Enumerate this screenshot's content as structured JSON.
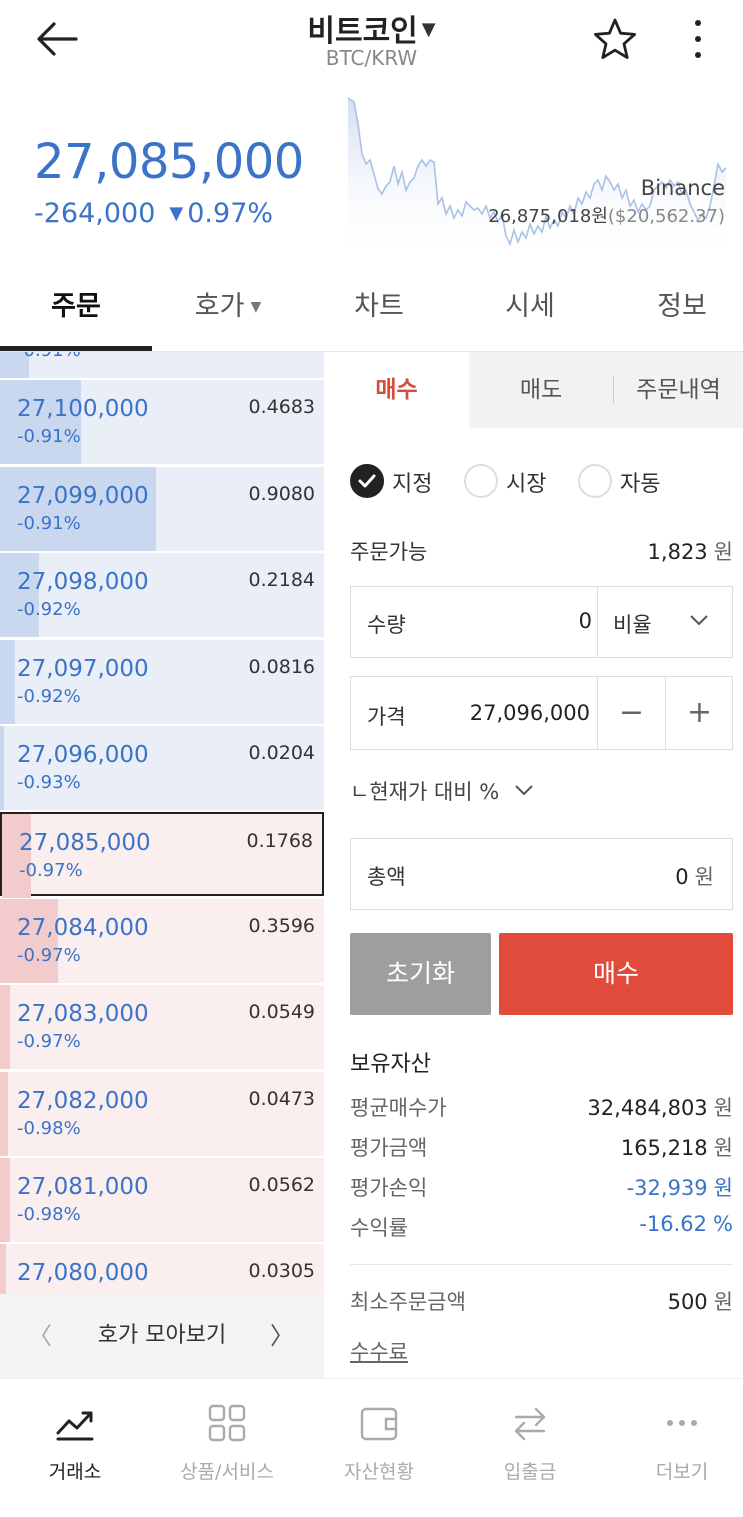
{
  "header": {
    "title": "비트코인",
    "subtitle": "BTC/KRW"
  },
  "ticker": {
    "price": "27,085,000",
    "change": "-264,000",
    "change_pct": "0.97%",
    "exchange": "Binance",
    "exchange_price": "26,875,018원",
    "exchange_usd": "($20,562.37)"
  },
  "tabs": [
    {
      "label": "주문"
    },
    {
      "label": "호가"
    },
    {
      "label": "차트"
    },
    {
      "label": "시세"
    },
    {
      "label": "정보"
    }
  ],
  "orderbook": {
    "rows": [
      {
        "price": "",
        "pct": "-0.91%",
        "qty": "",
        "side": "ask",
        "fill": 0.09
      },
      {
        "price": "27,100,000",
        "pct": "-0.91%",
        "qty": "0.4683",
        "side": "ask",
        "fill": 0.25
      },
      {
        "price": "27,099,000",
        "pct": "-0.91%",
        "qty": "0.9080",
        "side": "ask",
        "fill": 0.48
      },
      {
        "price": "27,098,000",
        "pct": "-0.92%",
        "qty": "0.2184",
        "side": "ask",
        "fill": 0.12
      },
      {
        "price": "27,097,000",
        "pct": "-0.92%",
        "qty": "0.0816",
        "side": "ask",
        "fill": 0.045
      },
      {
        "price": "27,096,000",
        "pct": "-0.93%",
        "qty": "0.0204",
        "side": "ask",
        "fill": 0.012
      },
      {
        "price": "27,085,000",
        "pct": "-0.97%",
        "qty": "0.1768",
        "side": "bid",
        "fill": 0.09,
        "current": true
      },
      {
        "price": "27,084,000",
        "pct": "-0.97%",
        "qty": "0.3596",
        "side": "bid",
        "fill": 0.18
      },
      {
        "price": "27,083,000",
        "pct": "-0.97%",
        "qty": "0.0549",
        "side": "bid",
        "fill": 0.03
      },
      {
        "price": "27,082,000",
        "pct": "-0.98%",
        "qty": "0.0473",
        "side": "bid",
        "fill": 0.025
      },
      {
        "price": "27,081,000",
        "pct": "-0.98%",
        "qty": "0.0562",
        "side": "bid",
        "fill": 0.03
      },
      {
        "price": "27,080,000",
        "pct": "",
        "qty": "0.0305",
        "side": "bid",
        "fill": 0.017
      }
    ],
    "footer_label": "호가 모아보기"
  },
  "order_tabs": [
    {
      "label": "매수"
    },
    {
      "label": "매도"
    },
    {
      "label": "주문내역"
    }
  ],
  "order_types": [
    {
      "label": "지정",
      "checked": true
    },
    {
      "label": "시장",
      "checked": false
    },
    {
      "label": "자동",
      "checked": false
    }
  ],
  "form": {
    "available_label": "주문가능",
    "available_value": "1,823",
    "unit": "원",
    "qty_label": "수량",
    "qty_value": "0",
    "ratio_label": "비율",
    "price_label": "가격",
    "price_value": "27,096,000",
    "minus": "−",
    "plus": "+",
    "compare_label": "ㄴ현재가 대비 %",
    "total_label": "총액",
    "total_value": "0",
    "reset_label": "초기화",
    "buy_label": "매수"
  },
  "holdings": {
    "title": "보유자산",
    "rows": [
      {
        "label": "평균매수가",
        "value": "32,484,803",
        "unit": "원",
        "negative": false
      },
      {
        "label": "평가금액",
        "value": "165,218",
        "unit": "원",
        "negative": false
      },
      {
        "label": "평가손익",
        "value": "-32,939",
        "unit": "원",
        "negative": true
      },
      {
        "label": "수익률",
        "value": "-16.62",
        "unit": "%",
        "negative": true
      }
    ],
    "min_order_label": "최소주문금액",
    "min_order_value": "500",
    "fee_label": "수수료"
  },
  "bottom_nav": [
    {
      "label": "거래소",
      "icon": "trend-icon",
      "active": true
    },
    {
      "label": "상품/서비스",
      "icon": "grid-icon",
      "active": false
    },
    {
      "label": "자산현황",
      "icon": "wallet-icon",
      "active": false
    },
    {
      "label": "입출금",
      "icon": "transfer-icon",
      "active": false
    },
    {
      "label": "더보기",
      "icon": "more-dots-icon",
      "active": false
    }
  ],
  "colors": {
    "down": "#3b73c9",
    "buy": "#e04b3c",
    "reset": "#9e9e9e"
  }
}
